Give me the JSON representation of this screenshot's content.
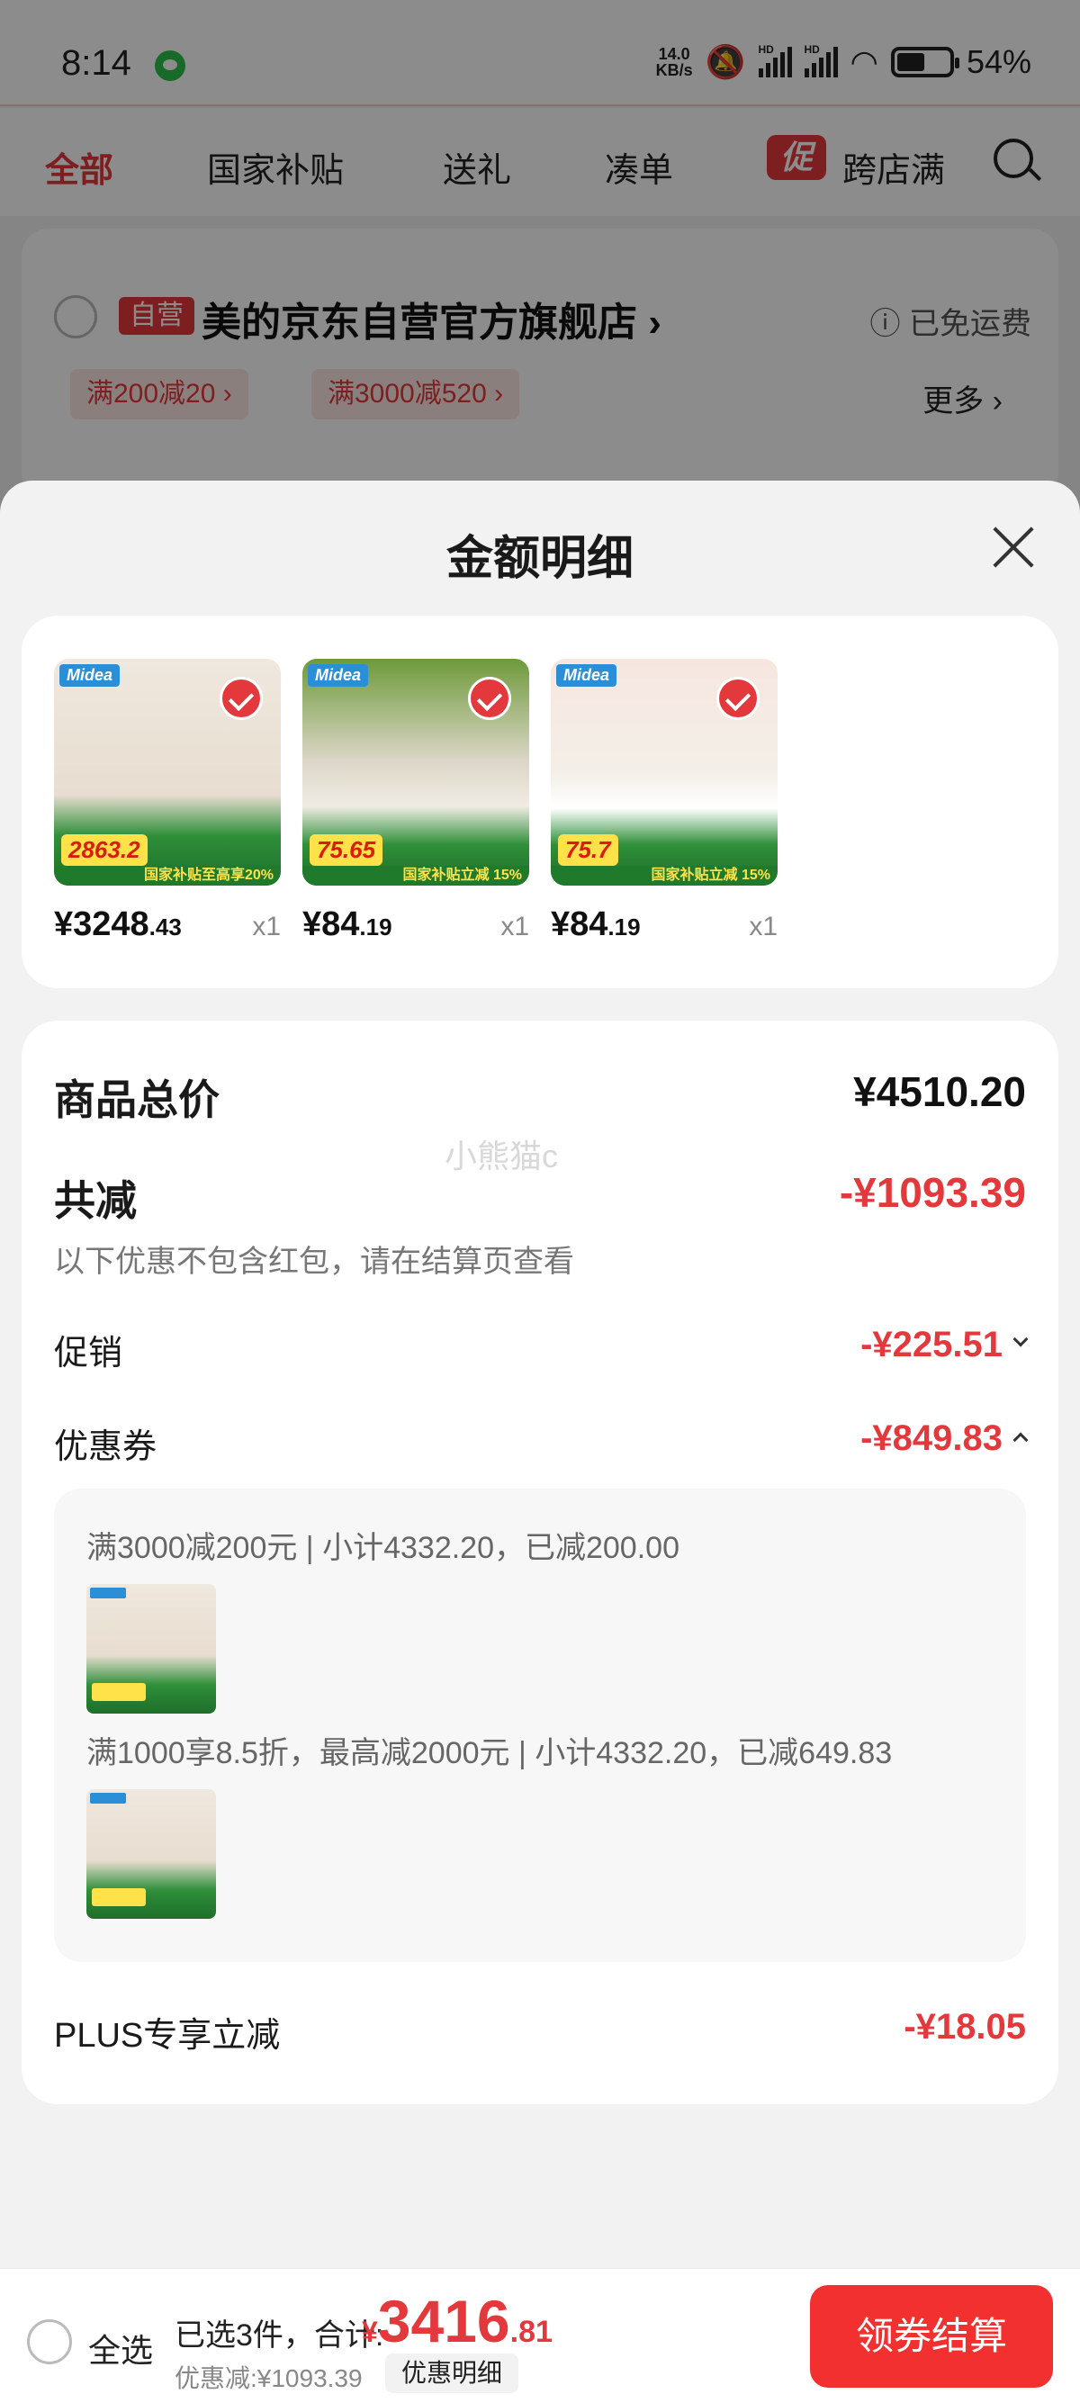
{
  "status_bar": {
    "time": "8:14",
    "net_speed_value": "14.0",
    "net_speed_unit": "KB/s",
    "signal1_label": "HD",
    "signal2_label": "HD",
    "battery": "54%"
  },
  "top_tabs": [
    {
      "label": "全部",
      "active": true
    },
    {
      "label": "国家补贴",
      "active": false
    },
    {
      "label": "送礼",
      "active": false
    },
    {
      "label": "凑单",
      "active": false
    },
    {
      "label": "跨店满",
      "active": false
    }
  ],
  "promo_chip": "促",
  "store": {
    "badge": "自营",
    "name": "美的京东自营官方旗舰店",
    "shipping": "已免运费",
    "coupons": [
      "满200减20",
      "满3000减520"
    ],
    "more": "更多"
  },
  "sheet": {
    "title": "金额明细",
    "products": [
      {
        "price_int": "¥3248",
        "price_dec": ".43",
        "qty": "x1",
        "promo_price": "2863.2",
        "gov_label": "国家补贴至高享20%",
        "icon": "fridge"
      },
      {
        "price_int": "¥84",
        "price_dec": ".19",
        "qty": "x1",
        "promo_price": "75.65",
        "gov_label": "国家补贴立减 15%",
        "icon": "electric-pot"
      },
      {
        "price_int": "¥84",
        "price_dec": ".19",
        "qty": "x1",
        "promo_price": "75.7",
        "gov_label": "国家补贴立减 15%",
        "icon": "egg-steamer"
      }
    ],
    "brand": "Midea",
    "total_label": "商品总价",
    "total_value": "¥4510.20",
    "discount_label": "共减",
    "discount_value": "-¥1093.39",
    "watermark": "小熊猫c",
    "discount_note": "以下优惠不包含红包，请在结算页查看",
    "promo_label": "促销",
    "promo_value": "-¥225.51",
    "coupon_label": "优惠券",
    "coupon_value": "-¥849.83",
    "coupon_lines": [
      "满3000减200元 | 小计4332.20，已减200.00",
      "满1000享8.5折，最高减2000元 | 小计4332.20，已减649.83"
    ],
    "plus_label": "PLUS专享立减",
    "plus_value": "-¥18.05"
  },
  "bottom_bar": {
    "select_all": "全选",
    "summary": "已选3件，合计:",
    "currency": "¥",
    "total_int": "3416",
    "total_dec": ".81",
    "saved": "优惠减:¥1093.39",
    "detail_btn": "优惠明细",
    "checkout": "领券结算"
  },
  "colors": {
    "accent": "#e4393c",
    "checkout": "#f23030",
    "gov_green": "#1f7a2b",
    "price_yellow": "#ffe14a"
  }
}
